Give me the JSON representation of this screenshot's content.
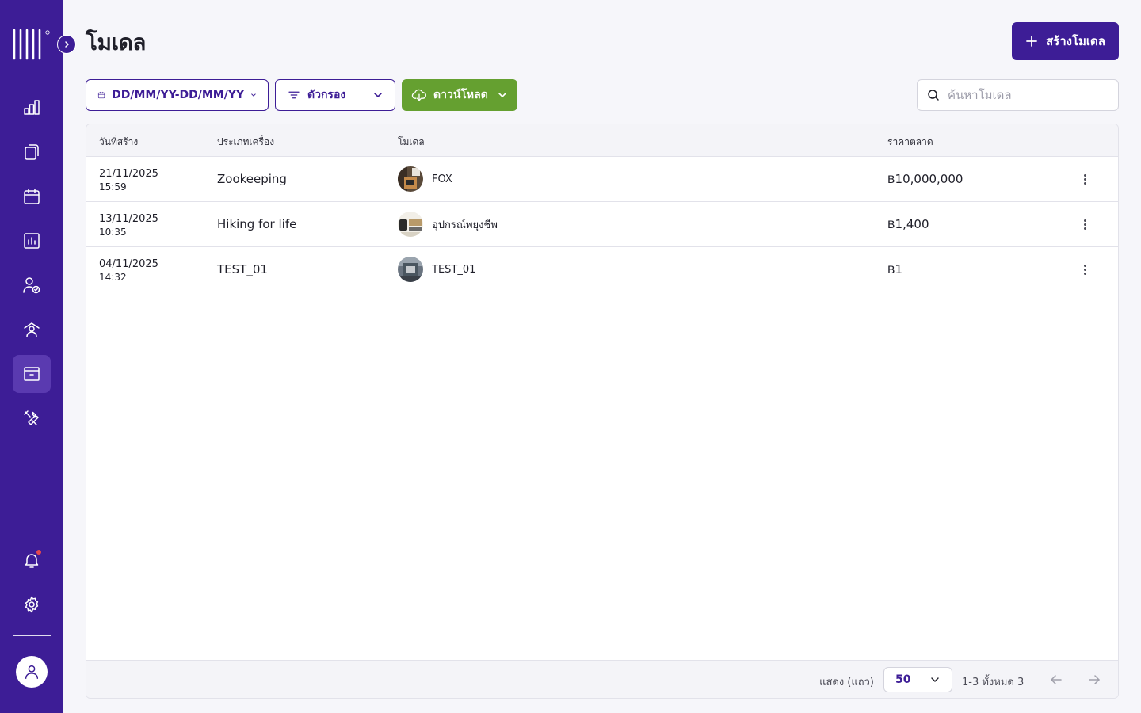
{
  "header": {
    "title": "โมเดล",
    "create_label": "สร้างโมเดล"
  },
  "toolbar": {
    "date_range_label": "DD/MM/YY-DD/MM/YY",
    "filter_label": "ตัวกรอง",
    "download_label": "ดาวน์โหลด",
    "search_placeholder": "ค้นหาโมเดล",
    "search_value": ""
  },
  "sidebar": {
    "items": [
      {
        "icon": "bar-chart-icon"
      },
      {
        "icon": "documents-icon"
      },
      {
        "icon": "calendar-icon"
      },
      {
        "icon": "report-icon"
      },
      {
        "icon": "user-check-icon"
      },
      {
        "icon": "staff-icon"
      },
      {
        "icon": "archive-icon",
        "active": true
      },
      {
        "icon": "tools-icon"
      }
    ],
    "bottom": [
      {
        "icon": "bell-icon",
        "has_notification": true
      },
      {
        "icon": "gear-icon"
      },
      {
        "icon": "user-avatar-icon"
      }
    ]
  },
  "table": {
    "columns": [
      "วันที่สร้าง",
      "ประเภทเครื่อง",
      "โมเดล",
      "ราคาตลาด"
    ],
    "rows": [
      {
        "date": "21/11/2025",
        "time": "15:59",
        "type": "Zookeeping",
        "model": "FOX",
        "price": "฿10,000,000"
      },
      {
        "date": "13/11/2025",
        "time": "10:35",
        "type": "Hiking for life",
        "model": "อุปกรณ์พยุงชีพ",
        "price": "฿1,400"
      },
      {
        "date": "04/11/2025",
        "time": "14:32",
        "type": "TEST_01",
        "model": "TEST_01",
        "price": "฿1"
      }
    ]
  },
  "footer": {
    "rows_label": "แสดง (แถว)",
    "rows_per_page": "50",
    "range_label": "1-3 ทั้งหมด 3"
  },
  "colors": {
    "brand": "#3d1d96",
    "download": "#65a030",
    "notification": "#e5484d"
  }
}
